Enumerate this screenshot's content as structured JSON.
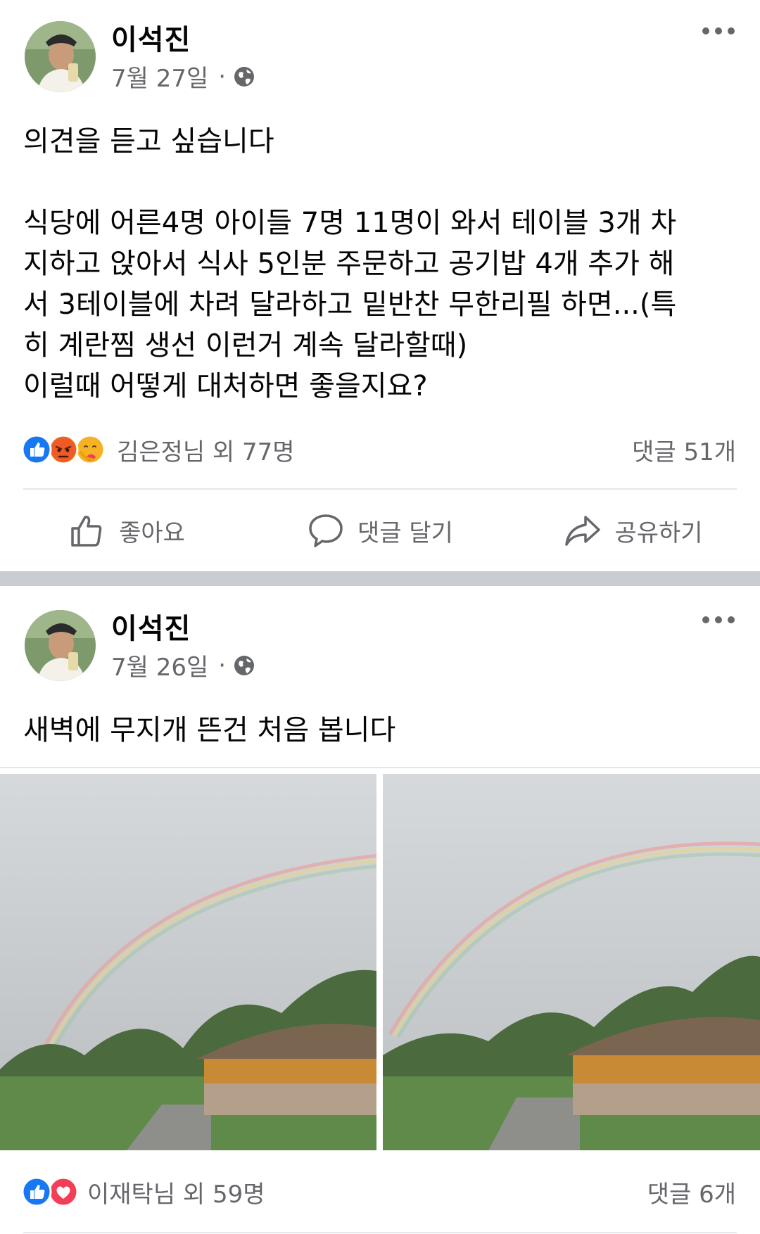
{
  "posts": [
    {
      "author": "이석진",
      "date": "7월 27일",
      "date_separator": "·",
      "paragraphs": [
        "의견을 듣고 싶습니다",
        "식당에 어른4명 아이들 7명 11명이 와서 테이블 3개 차\n지하고 앉아서 식사 5인분 주문하고 공기밥 4개 추가 해\n서 3테이블에 차려 달라하고 밑반찬 무한리필 하면...(특\n히 계란찜 생선 이런거 계속 달라할때)\n이럴때 어떻게 대처하면 좋을지요?"
      ],
      "reactions": [
        "like",
        "angry",
        "care"
      ],
      "reaction_text": "김은정님 외 77명",
      "comment_count": "댓글 51개"
    },
    {
      "author": "이석진",
      "date": "7월 26일",
      "date_separator": "·",
      "text": "새벽에 무지개 뜬건 처음 봅니다",
      "reactions": [
        "like",
        "love"
      ],
      "reaction_text": "이재탁님 외 59명",
      "comment_count": "댓글 6개"
    }
  ],
  "actions": {
    "like": "좋아요",
    "comment": "댓글 달기",
    "share": "공유하기"
  },
  "colors": {
    "like_blue": "#1877f2",
    "love_red": "#f33e58",
    "angry_orange": "#e9710f",
    "care_yellow": "#f7b125",
    "secondary_text": "#65676b",
    "separator": "#c9ccd1"
  },
  "icons": {
    "privacy": "globe-icon",
    "more": "more-options-icon",
    "like_action": "thumbs-up-icon",
    "comment_action": "comment-bubble-icon",
    "share_action": "share-arrow-icon"
  }
}
